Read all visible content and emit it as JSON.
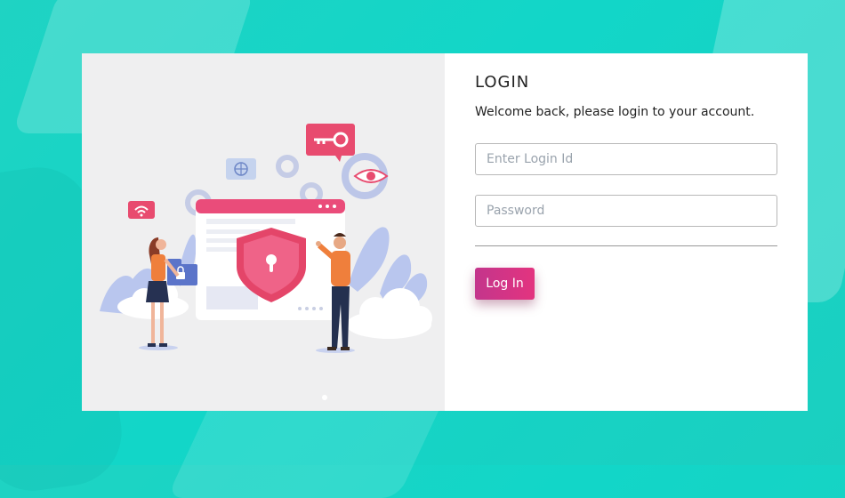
{
  "login": {
    "title": "LOGIN",
    "subtitle": "Welcome back, please login to your account.",
    "login_id_placeholder": "Enter Login Id",
    "password_placeholder": "Password",
    "button_label": "Log In"
  },
  "colors": {
    "background": "#12d6c8",
    "button_start": "#c3358c",
    "button_end": "#e3347f",
    "accent_pink": "#e84b6f"
  },
  "illustration": {
    "icons": [
      "wifi-icon",
      "globe-icon",
      "key-icon",
      "eye-icon",
      "gear-icon",
      "shield-lock-icon",
      "lock-icon"
    ]
  }
}
